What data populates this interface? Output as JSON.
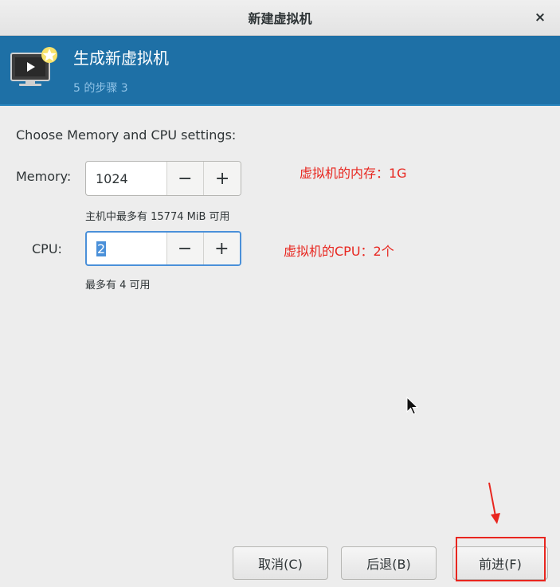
{
  "window": {
    "title": "新建虚拟机",
    "close_glyph": "×"
  },
  "banner": {
    "title": "生成新虚拟机",
    "subtitle": "5 的步骤 3",
    "icon": "monitor-icon",
    "bg_color": "#1e70a6"
  },
  "section": {
    "label": "Choose Memory and CPU settings:"
  },
  "memory": {
    "label": "Memory:",
    "value": "1024",
    "hint": "主机中最多有 15774 MiB 可用",
    "minus": "−",
    "plus": "+"
  },
  "cpu": {
    "label": "CPU:",
    "value": "2",
    "hint": "最多有 4 可用",
    "minus": "−",
    "plus": "+"
  },
  "annotations": {
    "memory_note": "虚拟机的内存：1G",
    "cpu_note": "虚拟机的CPU：2个",
    "color": "#e8261f"
  },
  "footer": {
    "cancel": "取消(C)",
    "back": "后退(B)",
    "forward": "前进(F)"
  }
}
